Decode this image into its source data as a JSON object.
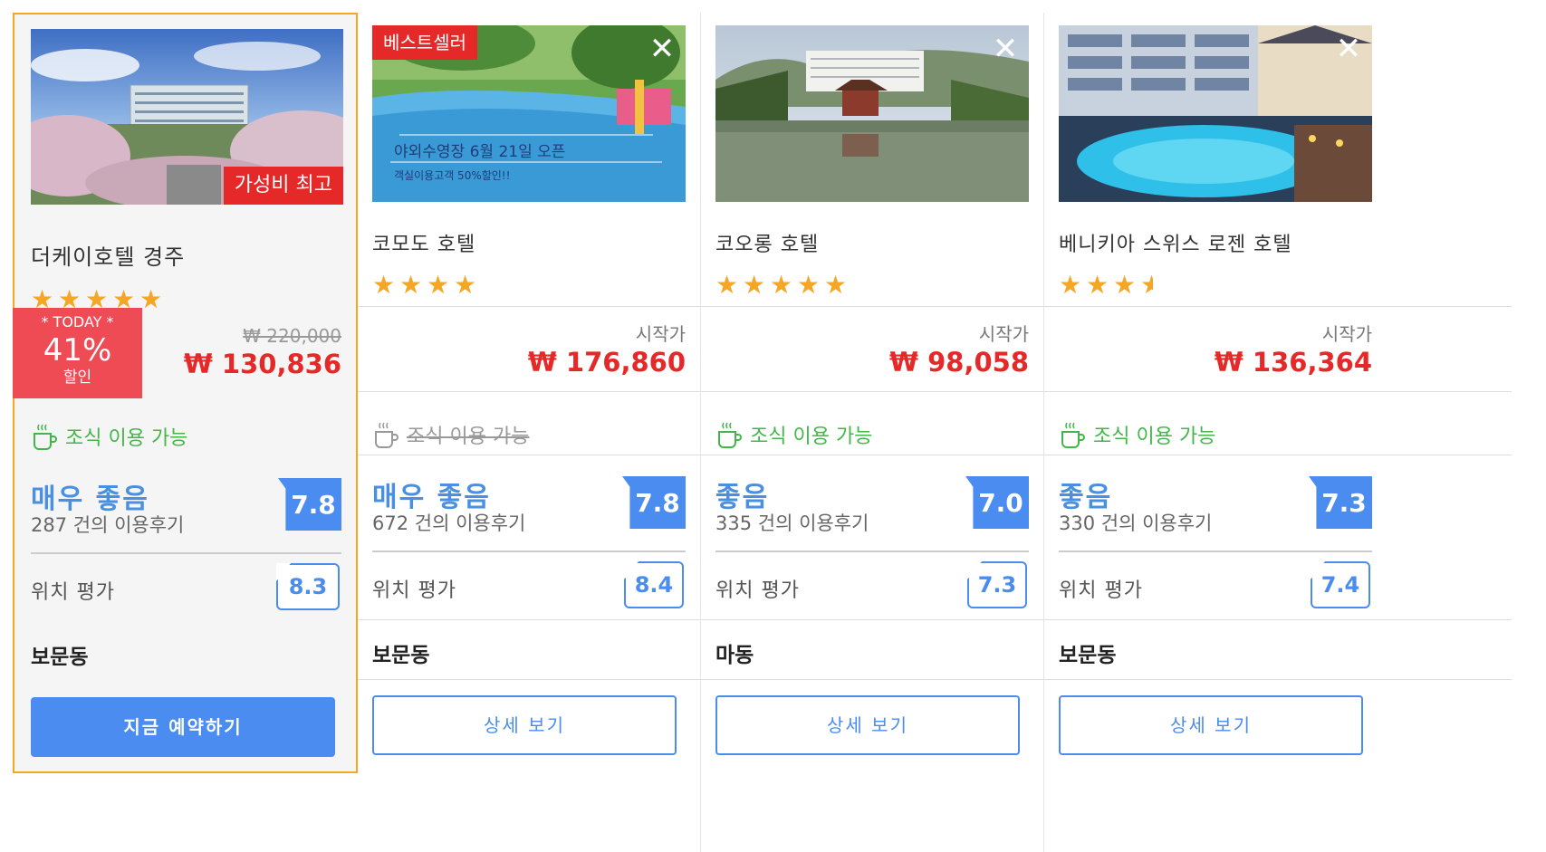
{
  "colors": {
    "accent_blue": "#4b8cf0",
    "price_red": "#e52828",
    "highlight_border": "#f5a623",
    "breakfast_green": "#43b649",
    "star": "#f5a623"
  },
  "cards": [
    {
      "photo_badge": "가성비 최고",
      "name": "더케이호텔 경주",
      "stars": 5,
      "deal": {
        "today": "* TODAY *",
        "percent": "41%",
        "label": "할인"
      },
      "original_price": "₩ 220,000",
      "start_label": "",
      "price": "₩ 130,836",
      "breakfast": "조식 이용 가능",
      "breakfast_available": true,
      "rating_word": "매우 좋음",
      "review_count": "287 건의 이용후기",
      "score": "7.8",
      "location_label": "위치 평가",
      "location_score": "8.3",
      "district": "보문동",
      "button": "지금 예약하기",
      "icons": [
        "coffee-cup-icon",
        "star-icon"
      ]
    },
    {
      "photo_badge": "베스트셀러",
      "photo_text_line1": "야외수영장 6월 21일 오픈",
      "photo_text_line2": "객실이용고객 50%할인!!",
      "name": "코모도 호텔",
      "stars": 4,
      "start_label": "시작가",
      "price": "₩ 176,860",
      "breakfast": "조식 이용 가능",
      "breakfast_available": false,
      "rating_word": "매우 좋음",
      "review_count": "672 건의 이용후기",
      "score": "7.8",
      "location_label": "위치 평가",
      "location_score": "8.4",
      "district": "보문동",
      "button": "상세 보기"
    },
    {
      "name": "코오롱 호텔",
      "stars": 5,
      "start_label": "시작가",
      "price": "₩ 98,058",
      "breakfast": "조식 이용 가능",
      "breakfast_available": true,
      "rating_word": "좋음",
      "review_count": "335 건의 이용후기",
      "score": "7.0",
      "location_label": "위치 평가",
      "location_score": "7.3",
      "district": "마동",
      "button": "상세 보기"
    },
    {
      "name": "베니키아 스위스 로젠 호텔",
      "stars": 3.5,
      "start_label": "시작가",
      "price": "₩ 136,364",
      "breakfast": "조식 이용 가능",
      "breakfast_available": true,
      "rating_word": "좋음",
      "review_count": "330 건의 이용후기",
      "score": "7.3",
      "location_label": "위치 평가",
      "location_score": "7.4",
      "district": "보문동",
      "button": "상세 보기"
    }
  ],
  "close_symbol": "✕"
}
